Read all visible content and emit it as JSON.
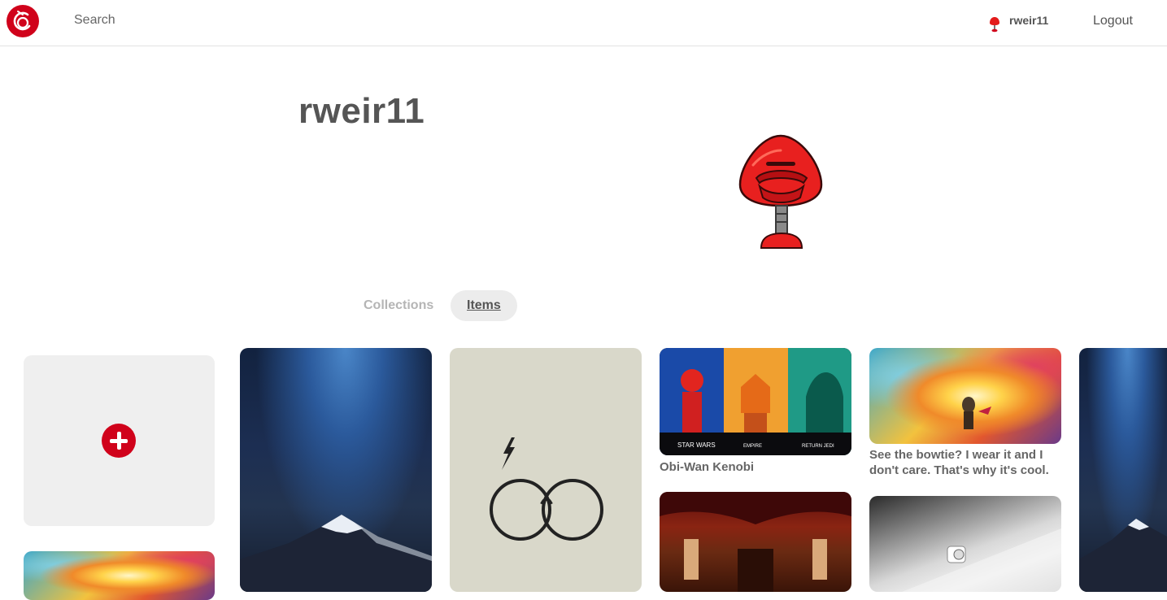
{
  "nav": {
    "search_label": "Search",
    "username": "rweir11",
    "logout_label": "Logout"
  },
  "profile": {
    "name": "rweir11"
  },
  "tabs": [
    {
      "label": "Collections",
      "active": false
    },
    {
      "label": "Items",
      "active": true
    }
  ],
  "items": [
    {
      "caption": "Obi-Wan Kenobi"
    },
    {
      "caption": "See the bowtie? I wear it and I don't care. That's why it's cool."
    }
  ],
  "icons": {
    "logo": "app-logo-icon",
    "add": "plus-circle-icon",
    "avatar": "mushroom-robot-icon"
  },
  "colors": {
    "brand": "#d0021b",
    "tab_active_bg": "#ececec"
  }
}
